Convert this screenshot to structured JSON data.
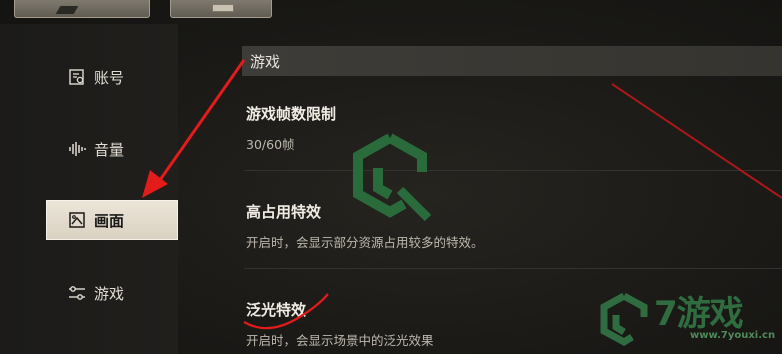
{
  "sidebar": {
    "items": [
      {
        "label": "账号",
        "icon": "account-icon",
        "active": false
      },
      {
        "label": "音量",
        "icon": "volume-icon",
        "active": false
      },
      {
        "label": "画面",
        "icon": "graphics-icon",
        "active": true
      },
      {
        "label": "游戏",
        "icon": "game-settings-icon",
        "active": false
      }
    ]
  },
  "main": {
    "section_title": "游戏",
    "settings": [
      {
        "title": "游戏帧数限制",
        "desc": "30/60帧"
      },
      {
        "title": "高占用特效",
        "desc": "开启时，会显示部分资源占用较多的特效。"
      },
      {
        "title": "泛光特效",
        "desc": "开启时，会显示场景中的泛光效果"
      }
    ]
  },
  "watermark": {
    "text": "7游戏",
    "url": "www.7youxi.cn"
  },
  "colors": {
    "annotation": "#e21b1b",
    "watermark": "#2f6d40",
    "active_tab": "#e6dfd1"
  }
}
